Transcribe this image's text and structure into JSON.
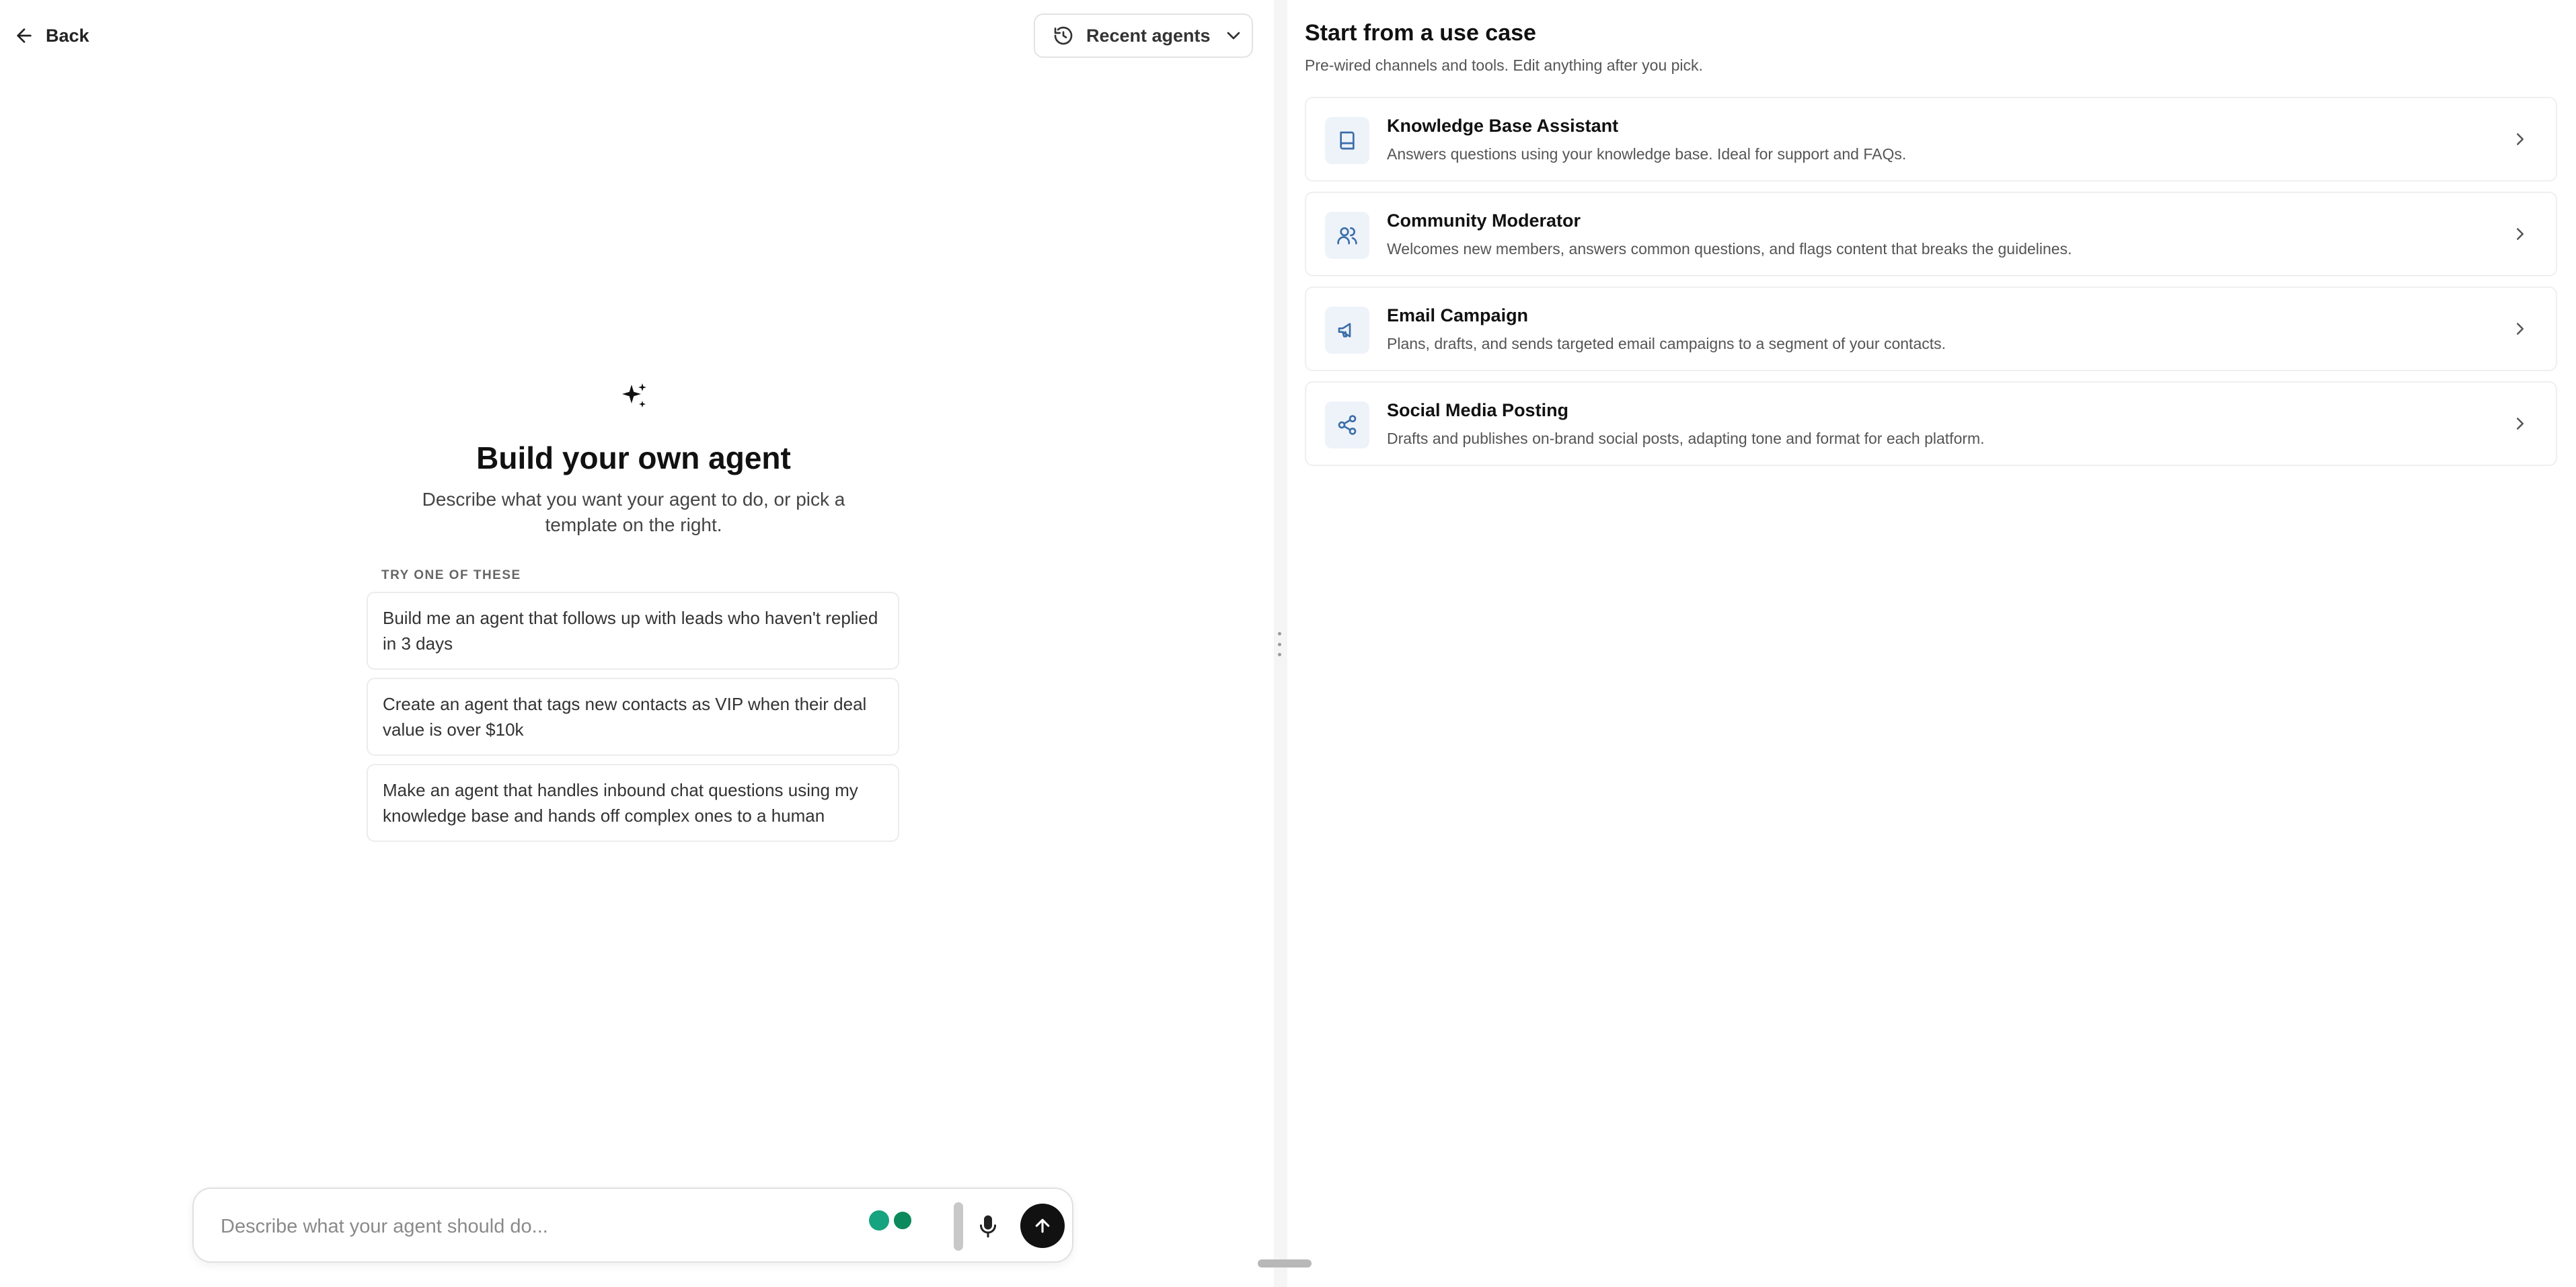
{
  "header": {
    "back_label": "Back",
    "recent_agents_label": "Recent agents"
  },
  "builder": {
    "title": "Build your own agent",
    "subtitle": "Describe what you want your agent to do, or pick a template on the right.",
    "suggestions_label": "TRY ONE OF THESE",
    "suggestions": [
      "Build me an agent that follows up with leads who haven't replied in 3 days",
      "Create an agent that tags new contacts as VIP when their deal value is over $10k",
      "Make an agent that handles inbound chat questions using my knowledge base and hands off complex ones to a human"
    ],
    "composer_placeholder": "Describe what your agent should do..."
  },
  "use_cases": {
    "title": "Start from a use case",
    "subtitle": "Pre-wired channels and tools. Edit anything after you pick.",
    "items": [
      {
        "title": "Knowledge Base Assistant",
        "description": "Answers questions using your knowledge base. Ideal for support and FAQs.",
        "icon": "book-icon"
      },
      {
        "title": "Community Moderator",
        "description": "Welcomes new members, answers common questions, and flags content that breaks the guidelines.",
        "icon": "users-icon"
      },
      {
        "title": "Email Campaign",
        "description": "Plans, drafts, and sends targeted email campaigns to a segment of your contacts.",
        "icon": "megaphone-icon"
      },
      {
        "title": "Social Media Posting",
        "description": "Drafts and publishes on-brand social posts, adapting tone and format for each platform.",
        "icon": "share-icon"
      }
    ]
  },
  "colors": {
    "accent": "#3b6ea8",
    "icon_bg": "#eef3fa",
    "send_button": "#111111"
  }
}
